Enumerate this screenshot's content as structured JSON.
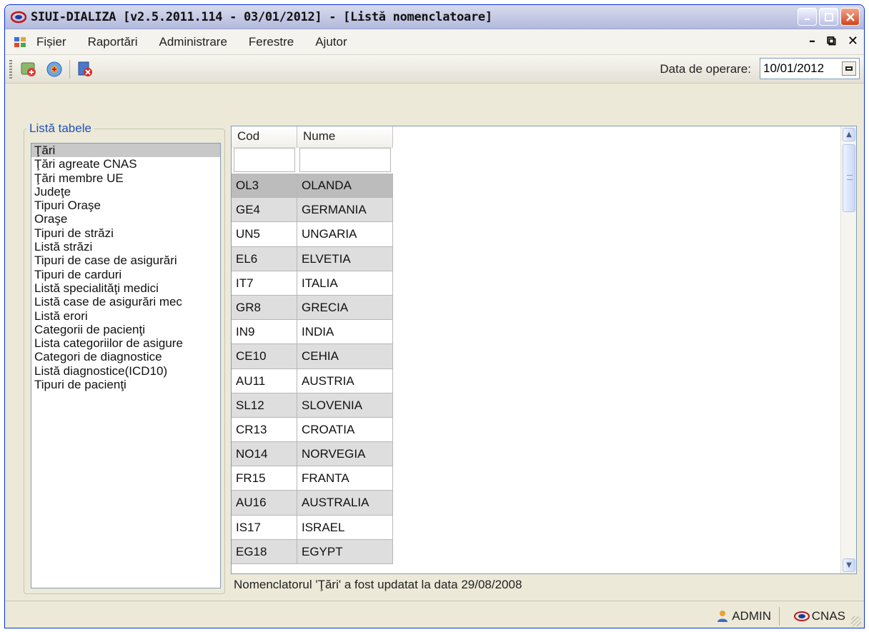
{
  "window": {
    "title": "SIUI-DIALIZA [v2.5.2011.114 - 03/01/2012] - [Listă nomenclatoare]"
  },
  "menu": {
    "items": [
      "Fișier",
      "Raportări",
      "Administrare",
      "Ferestre",
      "Ajutor"
    ]
  },
  "toolbar": {
    "date_label": "Data de operare:",
    "date_value": "10/01/2012"
  },
  "tables_panel": {
    "legend": "Listă tabele",
    "items": [
      "Ţări",
      "Ţări agreate CNAS",
      "Ţări membre UE",
      "Judeţe",
      "Tipuri Oraşe",
      "Oraşe",
      "Tipuri de străzi",
      "Listă străzi",
      "Tipuri de case de asigurări",
      "Tipuri de carduri",
      "Listă specialităţi medici",
      "Listă case de asigurări mec",
      "Listă erori",
      "Categorii de pacienţi",
      "Lista categoriilor de asigure",
      "Categori de diagnostice",
      "Listă diagnostice(ICD10)",
      "Tipuri de pacienţi"
    ],
    "selected_index": 0
  },
  "grid": {
    "columns": [
      "Cod",
      "Nume"
    ],
    "rows": [
      [
        "OL3",
        "OLANDA"
      ],
      [
        "GE4",
        "GERMANIA"
      ],
      [
        "UN5",
        "UNGARIA"
      ],
      [
        "EL6",
        "ELVETIA"
      ],
      [
        "IT7",
        "ITALIA"
      ],
      [
        "GR8",
        "GRECIA"
      ],
      [
        "IN9",
        "INDIA"
      ],
      [
        "CE10",
        "CEHIA"
      ],
      [
        "AU11",
        "AUSTRIA"
      ],
      [
        "SL12",
        "SLOVENIA"
      ],
      [
        "CR13",
        "CROATIA"
      ],
      [
        "NO14",
        "NORVEGIA"
      ],
      [
        "FR15",
        "FRANTA"
      ],
      [
        "AU16",
        "AUSTRALIA"
      ],
      [
        "IS17",
        "ISRAEL"
      ],
      [
        "EG18",
        "EGYPT"
      ]
    ],
    "selected_row": 0
  },
  "status_note": "Nomenclatorul 'Ţări' a fost updatat la data 29/08/2008",
  "statusbar": {
    "user": "ADMIN",
    "org": "CNAS"
  },
  "colors": {
    "title_accent": "#2351b5",
    "close_button": "#d4441f",
    "selection_gray": "#bcbcbc"
  }
}
